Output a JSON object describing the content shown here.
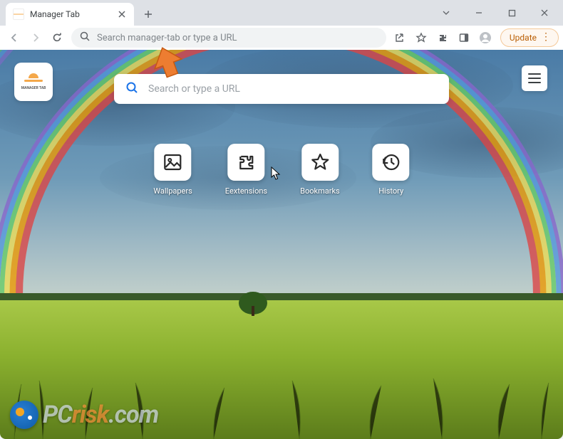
{
  "window": {
    "tab_title": "Manager Tab"
  },
  "toolbar": {
    "omnibox_placeholder": "Search manager-tab or type a URL",
    "update_label": "Update"
  },
  "page": {
    "logo_text": "MANAGER TAB",
    "search_placeholder": "Search or type a URL",
    "launcher": [
      {
        "label": "Wallpapers",
        "icon": "image"
      },
      {
        "label": "Eextensions",
        "icon": "puzzle"
      },
      {
        "label": "Bookmarks",
        "icon": "star"
      },
      {
        "label": "History",
        "icon": "history"
      }
    ]
  },
  "watermark": {
    "pc": "PC",
    "risk": "risk",
    "tld": ".com"
  }
}
